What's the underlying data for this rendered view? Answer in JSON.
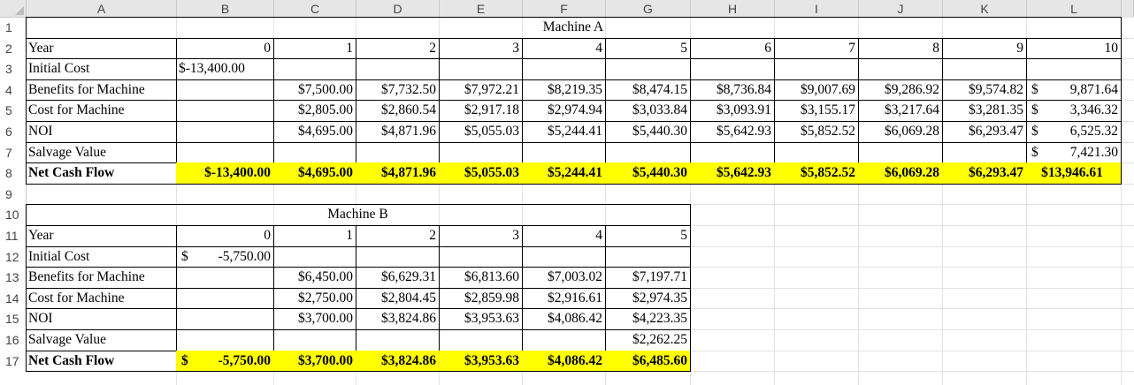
{
  "columns": [
    "A",
    "B",
    "C",
    "D",
    "E",
    "F",
    "G",
    "H",
    "I",
    "J",
    "K",
    "L"
  ],
  "rows": [
    "1",
    "2",
    "3",
    "4",
    "5",
    "6",
    "7",
    "8",
    "9",
    "10",
    "11",
    "12",
    "13",
    "14",
    "15",
    "16",
    "17"
  ],
  "machine_a": {
    "title": "Machine A",
    "labels": [
      "Year",
      "Initial Cost",
      "Benefits for Machine",
      "Cost for Machine",
      "NOI",
      "Salvage Value",
      "Net Cash Flow"
    ],
    "years": [
      "0",
      "1",
      "2",
      "3",
      "4",
      "5",
      "6",
      "7",
      "8",
      "9",
      "10"
    ],
    "initial_cost": "$-13,400.00",
    "benefits": [
      "$7,500.00",
      "$7,732.50",
      "$7,972.21",
      "$8,219.35",
      "$8,474.15",
      "$8,736.84",
      "$9,007.69",
      "$9,286.92",
      "$9,574.82",
      "9,871.64"
    ],
    "cost": [
      "$2,805.00",
      "$2,860.54",
      "$2,917.18",
      "$2,974.94",
      "$3,033.84",
      "$3,093.91",
      "$3,155.17",
      "$3,217.64",
      "$3,281.35",
      "3,346.32"
    ],
    "noi": [
      "$4,695.00",
      "$4,871.96",
      "$5,055.03",
      "$5,244.41",
      "$5,440.30",
      "$5,642.93",
      "$5,852.52",
      "$6,069.28",
      "$6,293.47",
      "6,525.32"
    ],
    "salvage": "7,421.30",
    "net_cash_flow": [
      "$-13,400.00",
      "$4,695.00",
      "$4,871.96",
      "$5,055.03",
      "$5,244.41",
      "$5,440.30",
      "$5,642.93",
      "$5,852.52",
      "$6,069.28",
      "$6,293.47",
      "$13,946.61"
    ],
    "currency_symbol": "$"
  },
  "machine_b": {
    "title": "Machine B",
    "labels": [
      "Year",
      "Initial Cost",
      "Benefits for Machine",
      "Cost for Machine",
      "NOI",
      "Salvage Value",
      "Net Cash Flow"
    ],
    "years": [
      "0",
      "1",
      "2",
      "3",
      "4",
      "5"
    ],
    "initial_cost_amt": "-5,750.00",
    "benefits": [
      "$6,450.00",
      "$6,629.31",
      "$6,813.60",
      "$7,003.02",
      "$7,197.71"
    ],
    "cost": [
      "$2,750.00",
      "$2,804.45",
      "$2,859.98",
      "$2,916.61",
      "$2,974.35"
    ],
    "noi": [
      "$3,700.00",
      "$3,824.86",
      "$3,953.63",
      "$4,086.42",
      "$4,223.35"
    ],
    "salvage": "$2,262.25",
    "net_cash_flow_0_amt": "-5,750.00",
    "net_cash_flow": [
      "$3,700.00",
      "$3,824.86",
      "$3,953.63",
      "$4,086.42",
      "$6,485.60"
    ],
    "currency_symbol": "$"
  },
  "colors": {
    "highlight": "#ffff00",
    "header_bg": "#e6e6e6",
    "gridline": "#e2e2e2"
  }
}
